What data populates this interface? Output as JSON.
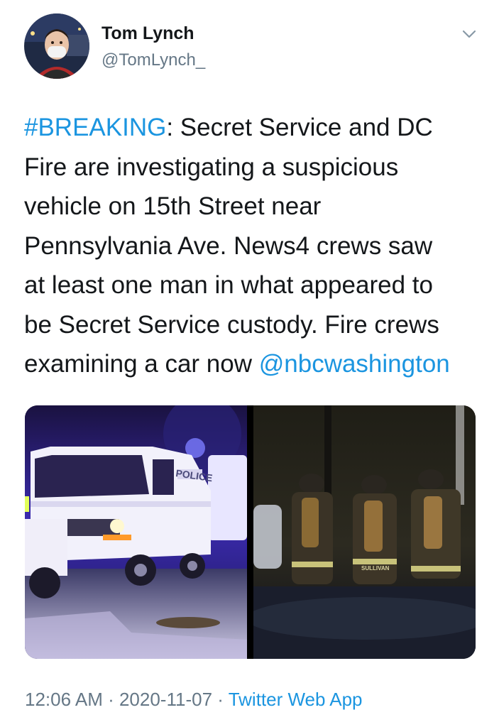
{
  "author": {
    "name": "Tom Lynch",
    "handle": "@TomLynch_",
    "avatar_icon": "avatar-photo"
  },
  "header": {
    "more_icon": "chevron-down-icon"
  },
  "tweet": {
    "hashtag": "#BREAKING",
    "line1_rest": ": Secret Service and DC",
    "line2": "Fire are investigating a suspicious",
    "line3": "vehicle on 15th Street near",
    "line4": "Pennsylvania Ave. News4 crews saw",
    "line5": "at least one man in what appeared to",
    "line6": "be Secret Service custody. Fire crews",
    "line7_prefix": "examining a car now ",
    "mention": "@nbcwashington"
  },
  "media": {
    "photo1_text": "POLICE",
    "photo2_text": "SULLIVAN"
  },
  "meta": {
    "time": "12:06 AM",
    "sep1": " · ",
    "date": "2020-11-07",
    "sep2": " · ",
    "source": "Twitter Web App"
  },
  "colors": {
    "link": "#1b95e0",
    "secondary": "#657786",
    "text": "#14171a"
  }
}
